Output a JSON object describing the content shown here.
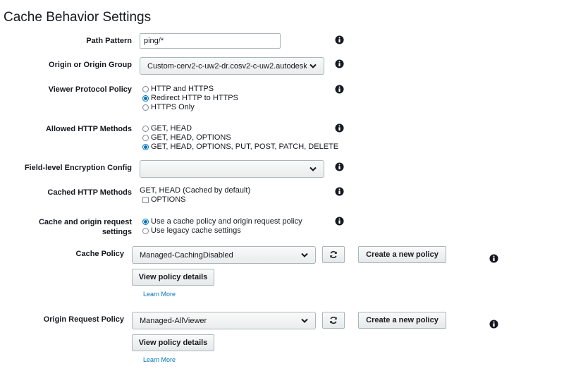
{
  "section_title": "Cache Behavior Settings",
  "fields": {
    "path_pattern": {
      "label": "Path Pattern",
      "value": "ping/*"
    },
    "origin": {
      "label": "Origin or Origin Group",
      "value": "Custom-cerv2-c-uw2-dr.cosv2-c-uw2.autodesk"
    },
    "viewer_protocol": {
      "label": "Viewer Protocol Policy",
      "options": [
        "HTTP and HTTPS",
        "Redirect HTTP to HTTPS",
        "HTTPS Only"
      ],
      "selected": 1
    },
    "allowed_methods": {
      "label": "Allowed HTTP Methods",
      "options": [
        "GET, HEAD",
        "GET, HEAD, OPTIONS",
        "GET, HEAD, OPTIONS, PUT, POST, PATCH, DELETE"
      ],
      "selected": 2
    },
    "fle_config": {
      "label": "Field-level Encryption Config",
      "value": ""
    },
    "cached_methods": {
      "label": "Cached HTTP Methods",
      "text": "GET, HEAD (Cached by default)",
      "options_label": "OPTIONS",
      "options_checked": false
    },
    "cache_settings": {
      "label_line1": "Cache and origin request",
      "label_line2": "settings",
      "options": [
        "Use a cache policy and origin request policy",
        "Use legacy cache settings"
      ],
      "selected": 0
    },
    "cache_policy": {
      "label": "Cache Policy",
      "value": "Managed-CachingDisabled",
      "create_label": "Create a new policy",
      "details_label": "View policy details",
      "learn_more": "Learn More"
    },
    "origin_request_policy": {
      "label": "Origin Request Policy",
      "value": "Managed-AllViewer",
      "create_label": "Create a new policy",
      "details_label": "View policy details",
      "learn_more": "Learn More"
    }
  },
  "icons": {
    "info": "info-circle-icon",
    "dropdown": "chevron-down-icon",
    "refresh": "refresh-icon"
  },
  "colors": {
    "link": "#0073bb",
    "radio_selected": "#0073bb",
    "text": "#16191f"
  }
}
